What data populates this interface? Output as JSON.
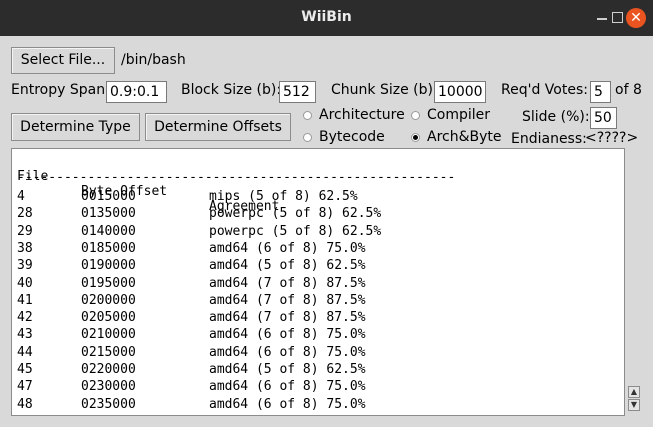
{
  "window": {
    "title": "WiiBin",
    "close_glyph": "✕"
  },
  "file": {
    "button_label": "Select File...",
    "path": "/bin/bash"
  },
  "params": {
    "entropy_span_label": "Entropy Span:",
    "entropy_span_value": "0.9:0.1",
    "block_size_label": "Block Size (b):",
    "block_size_value": "512",
    "chunk_size_label": "Chunk Size (b):",
    "chunk_size_value": "10000",
    "votes_label": "Req'd Votes:",
    "votes_value": "5",
    "votes_of": "of 8",
    "slide_label": "Slide (%):",
    "slide_value": "50",
    "endianess_label": "Endianess:",
    "endianess_value": "<????>"
  },
  "actions": {
    "determine_type": "Determine Type",
    "determine_offsets": "Determine Offsets"
  },
  "modes": [
    {
      "label": "Architecture",
      "selected": false
    },
    {
      "label": "Compiler",
      "selected": false
    },
    {
      "label": "Bytecode",
      "selected": false
    },
    {
      "label": "Arch&Byte",
      "selected": true
    }
  ],
  "results": {
    "headers": [
      "File",
      "Byte Offset",
      "Agreement"
    ],
    "separator": "--------------------------------------------------------",
    "rows": [
      [
        "4",
        "0015000",
        "mips (5 of 8) 62.5%"
      ],
      [
        "28",
        "0135000",
        "powerpc (5 of 8) 62.5%"
      ],
      [
        "29",
        "0140000",
        "powerpc (5 of 8) 62.5%"
      ],
      [
        "38",
        "0185000",
        "amd64 (6 of 8) 75.0%"
      ],
      [
        "39",
        "0190000",
        "amd64 (5 of 8) 62.5%"
      ],
      [
        "40",
        "0195000",
        "amd64 (7 of 8) 87.5%"
      ],
      [
        "41",
        "0200000",
        "amd64 (7 of 8) 87.5%"
      ],
      [
        "42",
        "0205000",
        "amd64 (7 of 8) 87.5%"
      ],
      [
        "43",
        "0210000",
        "amd64 (6 of 8) 75.0%"
      ],
      [
        "44",
        "0215000",
        "amd64 (6 of 8) 75.0%"
      ],
      [
        "45",
        "0220000",
        "amd64 (5 of 8) 62.5%"
      ],
      [
        "47",
        "0230000",
        "amd64 (6 of 8) 75.0%"
      ],
      [
        "48",
        "0235000",
        "amd64 (6 of 8) 75.0%"
      ]
    ]
  },
  "scrollbar": {
    "up_glyph": "▲",
    "down_glyph": "▼"
  },
  "colors": {
    "titlebar": "#2c2c2c",
    "window_bg": "#d9d9d9",
    "close_button": "#e95420"
  }
}
